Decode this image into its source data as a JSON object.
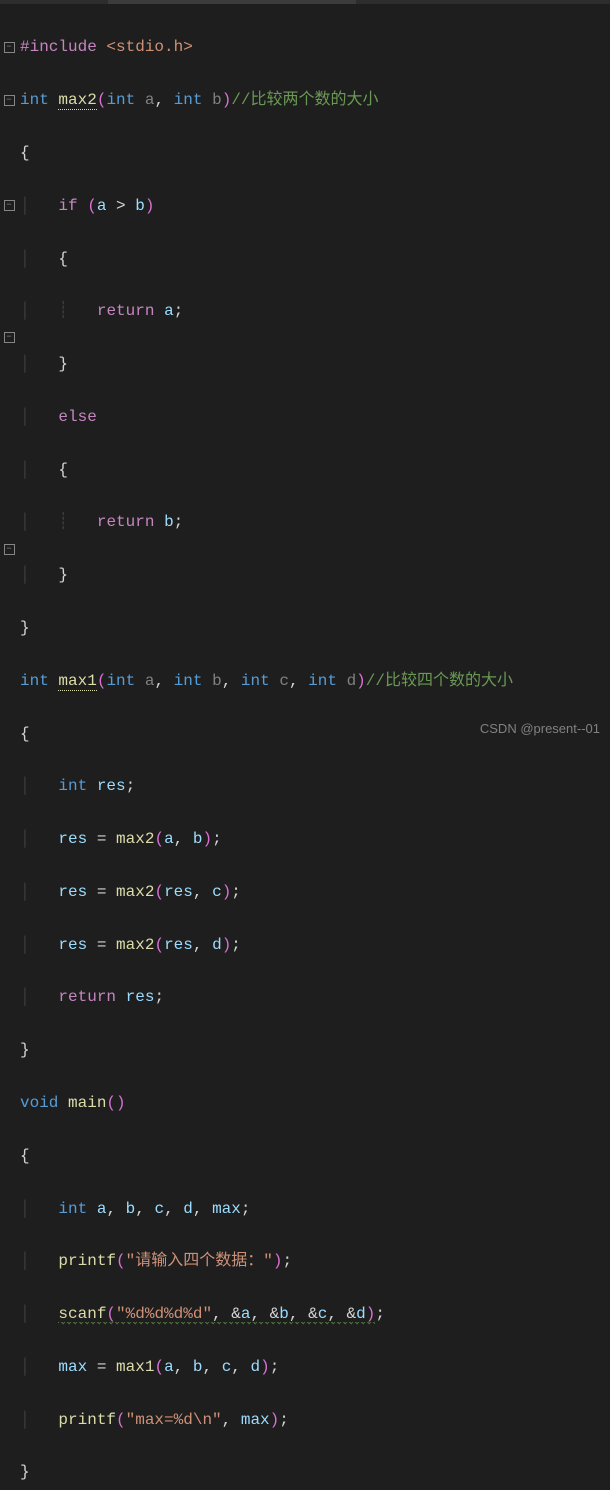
{
  "code": {
    "l1": {
      "pp": "#include",
      "hdr": "<stdio.h>"
    },
    "l2": {
      "type": "int",
      "fn": "max2",
      "p1t": "int",
      "p1n": "a",
      "p2t": "int",
      "p2n": "b",
      "comment": "//比较两个数的大小"
    },
    "l4": {
      "kw": "if",
      "var1": "a",
      "op": ">",
      "var2": "b"
    },
    "l6": {
      "kw": "return",
      "var": "a"
    },
    "l8": {
      "kw": "else"
    },
    "l10": {
      "kw": "return",
      "var": "b"
    },
    "l13": {
      "type": "int",
      "fn": "max1",
      "p1t": "int",
      "p1n": "a",
      "p2t": "int",
      "p2n": "b",
      "p3t": "int",
      "p3n": "c",
      "p4t": "int",
      "p4n": "d",
      "comment": "//比较四个数的大小"
    },
    "l15": {
      "type": "int",
      "var": "res"
    },
    "l16": {
      "lhs": "res",
      "fn": "max2",
      "a1": "a",
      "a2": "b"
    },
    "l17": {
      "lhs": "res",
      "fn": "max2",
      "a1": "res",
      "a2": "c"
    },
    "l18": {
      "lhs": "res",
      "fn": "max2",
      "a1": "res",
      "a2": "d"
    },
    "l19": {
      "kw": "return",
      "var": "res"
    },
    "l21": {
      "type": "void",
      "fn": "main"
    },
    "l23": {
      "type": "int",
      "v1": "a",
      "v2": "b",
      "v3": "c",
      "v4": "d",
      "v5": "max"
    },
    "l24": {
      "fn": "printf",
      "str": "\"请输入四个数据：\""
    },
    "l25": {
      "fn": "scanf",
      "str": "\"%d%d%d%d\"",
      "a1": "a",
      "a2": "b",
      "a3": "c",
      "a4": "d"
    },
    "l26": {
      "lhs": "max",
      "fn": "max1",
      "a1": "a",
      "a2": "b",
      "a3": "c",
      "a4": "d"
    },
    "l27": {
      "fn": "printf",
      "str": "\"max=%d\\n\"",
      "a1": "max"
    }
  },
  "watermark": "CSDN @present--01"
}
